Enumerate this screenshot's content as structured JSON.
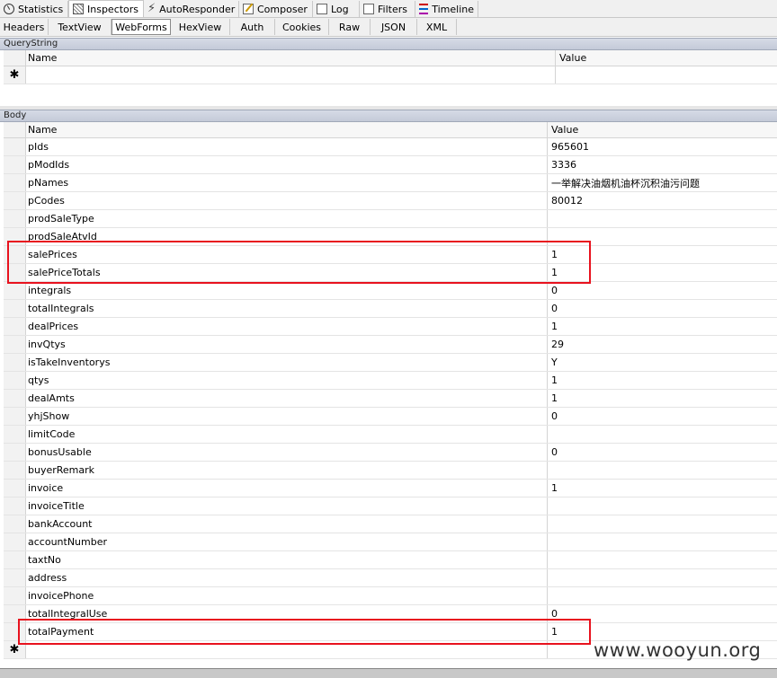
{
  "top_tabs": [
    {
      "label": "Statistics",
      "icon": "stopwatch-icon"
    },
    {
      "label": "Inspectors",
      "icon": "inspect-icon"
    },
    {
      "label": "AutoResponder",
      "icon": "lightning-icon"
    },
    {
      "label": "Composer",
      "icon": "pencil-icon"
    },
    {
      "label": "Log",
      "icon": "log-icon"
    },
    {
      "label": "Filters",
      "icon": "filter-icon"
    },
    {
      "label": "Timeline",
      "icon": "timeline-icon"
    }
  ],
  "sub_tabs": [
    "Headers",
    "TextView",
    "WebForms",
    "HexView",
    "Auth",
    "Cookies",
    "Raw",
    "JSON",
    "XML"
  ],
  "querystring": {
    "title": "QueryString",
    "col_name": "Name",
    "col_value": "Value",
    "new_row_marker": "✱"
  },
  "body": {
    "title": "Body",
    "col_name": "Name",
    "col_value": "Value",
    "new_row_marker": "✱",
    "rows": [
      {
        "name": "pIds",
        "value": "965601"
      },
      {
        "name": "pModIds",
        "value": "3336"
      },
      {
        "name": "pNames",
        "value": "一举解决油烟机油杯沉积油污问题"
      },
      {
        "name": "pCodes",
        "value": "80012"
      },
      {
        "name": "prodSaleType",
        "value": ""
      },
      {
        "name": "prodSaleAtvId",
        "value": ""
      },
      {
        "name": "salePrices",
        "value": "1"
      },
      {
        "name": "salePriceTotals",
        "value": "1"
      },
      {
        "name": "integrals",
        "value": "0"
      },
      {
        "name": "totalIntegrals",
        "value": "0"
      },
      {
        "name": "dealPrices",
        "value": "1"
      },
      {
        "name": "invQtys",
        "value": "29"
      },
      {
        "name": "isTakeInventorys",
        "value": "Y"
      },
      {
        "name": "qtys",
        "value": "1"
      },
      {
        "name": "dealAmts",
        "value": "1"
      },
      {
        "name": "yhjShow",
        "value": "0"
      },
      {
        "name": "limitCode",
        "value": ""
      },
      {
        "name": "bonusUsable",
        "value": "0"
      },
      {
        "name": "buyerRemark",
        "value": ""
      },
      {
        "name": "invoice",
        "value": "1"
      },
      {
        "name": "invoiceTitle",
        "value": ""
      },
      {
        "name": "bankAccount",
        "value": ""
      },
      {
        "name": "accountNumber",
        "value": ""
      },
      {
        "name": "taxtNo",
        "value": ""
      },
      {
        "name": "address",
        "value": ""
      },
      {
        "name": "invoicePhone",
        "value": ""
      },
      {
        "name": "totalIntegralUse",
        "value": "0"
      },
      {
        "name": "totalPayment",
        "value": "1"
      }
    ]
  },
  "highlight_color": "#e8121e",
  "watermark": "www.wooyun.org"
}
